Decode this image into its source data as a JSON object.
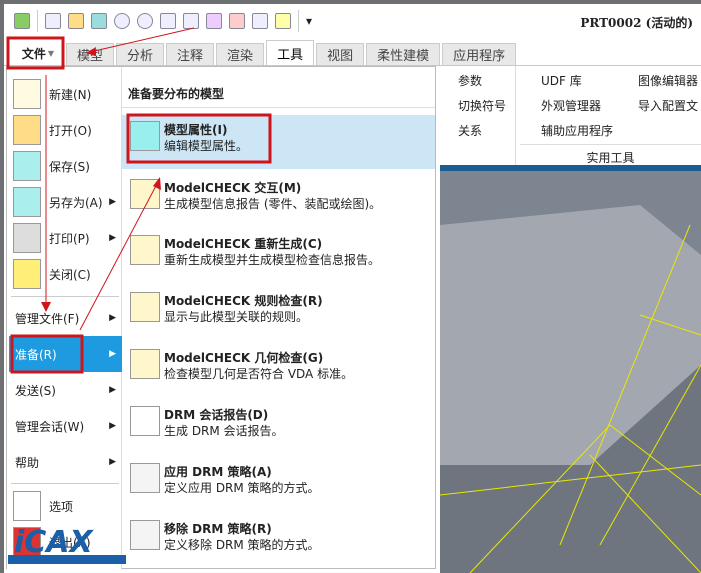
{
  "window": {
    "title": "PRT0002 (活动的)"
  },
  "quick_access": [
    "app-icon",
    "new-icon",
    "open-icon",
    "save-icon",
    "undo-icon",
    "redo-icon",
    "window-icon",
    "regenerate-icon",
    "icon-a",
    "icon-b",
    "icon-c",
    "icon-d",
    "customize-icon"
  ],
  "tabs": {
    "file": "文件",
    "items": [
      "模型",
      "分析",
      "注释",
      "渲染",
      "工具",
      "视图",
      "柔性建模",
      "应用程序"
    ],
    "active": "工具"
  },
  "ribbon": {
    "items": [
      "参数",
      "切换符号",
      "关系",
      "UDF 库",
      "外观管理器",
      "辅助应用程序",
      "图像编辑器",
      "导入配置文"
    ],
    "group": "实用工具"
  },
  "file_menu": {
    "items": [
      {
        "label": "新建(N)"
      },
      {
        "label": "打开(O)"
      },
      {
        "label": "保存(S)"
      },
      {
        "label": "另存为(A)"
      },
      {
        "label": "打印(P)"
      },
      {
        "label": "关闭(C)"
      },
      {
        "label": "管理文件(F)"
      },
      {
        "label": "准备(R)"
      },
      {
        "label": "发送(S)"
      },
      {
        "label": "管理会话(W)"
      },
      {
        "label": "帮助"
      },
      {
        "label": "选项"
      },
      {
        "label": "退出(X)"
      }
    ],
    "selected": "准备(R)"
  },
  "prepare_panel": {
    "header": "准备要分布的模型",
    "items": [
      {
        "title": "模型属性(I)",
        "desc": "编辑模型属性。"
      },
      {
        "title": "ModelCHECK 交互(M)",
        "desc": "生成模型信息报告 (零件、装配或绘图)。"
      },
      {
        "title": "ModelCHECK 重新生成(C)",
        "desc": "重新生成模型并生成模型检查信息报告。"
      },
      {
        "title": "ModelCHECK 规则检查(R)",
        "desc": "显示与此模型关联的规则。"
      },
      {
        "title": "ModelCHECK 几何检查(G)",
        "desc": "检查模型几何是否符合 VDA 标准。"
      },
      {
        "title": "DRM 会话报告(D)",
        "desc": "生成 DRM 会话报告。"
      },
      {
        "title": "应用 DRM 策略(A)",
        "desc": "定义应用 DRM 策略的方式。"
      },
      {
        "title": "移除 DRM 策略(R)",
        "desc": "定义移除 DRM 策略的方式。"
      }
    ]
  },
  "watermark": "WWW.ICAX.ORG",
  "colors": {
    "highlight": "#1e9be0",
    "panel_highlight": "#cde6f5",
    "annotation": "#d0141c"
  }
}
